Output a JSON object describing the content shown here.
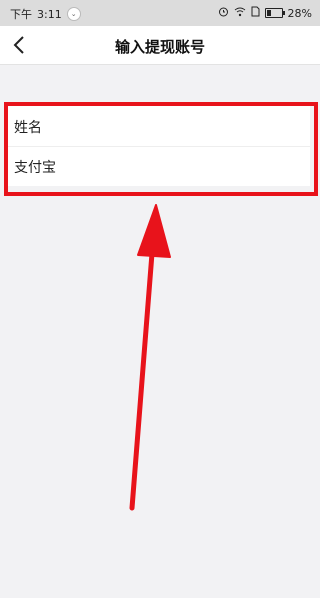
{
  "statusbar": {
    "time_label": "下午",
    "time_value": "3:11",
    "battery": "28%",
    "battery_level": 0.28
  },
  "header": {
    "title": "输入提现账号"
  },
  "form": {
    "name_label": "姓名",
    "alipay_label": "支付宝"
  },
  "colors": {
    "highlight": "#e8131b",
    "background": "#f2f2f4",
    "statusbar": "#dcdcdc"
  }
}
